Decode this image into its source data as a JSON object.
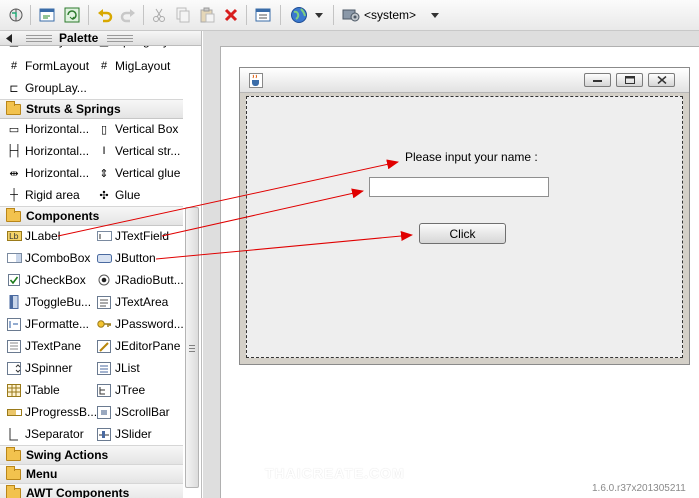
{
  "toolbar": {
    "system_dropdown": "<system>",
    "buttons": [
      "toggle-icon",
      "source-view-icon",
      "design-view-icon",
      "undo-icon",
      "redo-icon",
      "cut-icon",
      "copy-icon",
      "paste-icon",
      "delete-icon",
      "properties-icon",
      "look-and-feel-icon",
      "system-icon"
    ]
  },
  "palette": {
    "title": "Palette",
    "partial_top": [
      "BoxLayout",
      "SpringLay..."
    ],
    "layouts": [
      {
        "label": "FormLayout",
        "icon": "form-layout-icon"
      },
      {
        "label": "MigLayout",
        "icon": "mig-layout-icon"
      },
      {
        "label": "GroupLay...",
        "icon": "group-layout-icon"
      }
    ],
    "categories": {
      "struts": "Struts & Springs",
      "components": "Components",
      "swing_actions": "Swing Actions",
      "menu": "Menu",
      "awt": "AWT Components"
    },
    "struts_items": [
      "Horizontal...",
      "Vertical Box",
      "Horizontal...",
      "Vertical str...",
      "Horizontal...",
      "Vertical glue",
      "Rigid area",
      "Glue"
    ],
    "component_items": [
      "JLabel",
      "JTextField",
      "JComboBox",
      "JButton",
      "JCheckBox",
      "JRadioButt...",
      "JToggleBu...",
      "JTextArea",
      "JFormatte...",
      "JPassword...",
      "JTextPane",
      "JEditorPane",
      "JSpinner",
      "JList",
      "JTable",
      "JTree",
      "JProgressB...",
      "JScrollBar",
      "JSeparator",
      "JSlider"
    ]
  },
  "design": {
    "label_text": "Please input your name :",
    "text_field_value": "",
    "button_label": "Click"
  },
  "watermark": "THAICREATE.COM",
  "version": "1.6.0.r37x201305211",
  "colors": {
    "arrow": "#e00000",
    "frame_bg": "#d4d0c8",
    "content_bg": "#eeeeee"
  }
}
